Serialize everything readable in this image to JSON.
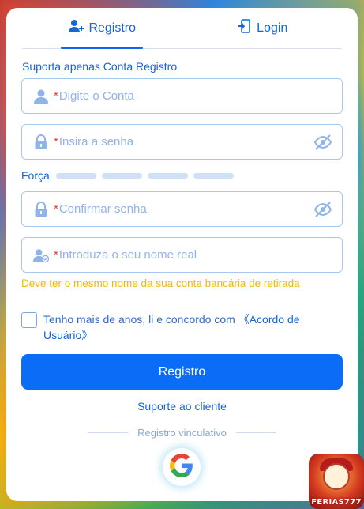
{
  "tabs": {
    "register": "Registro",
    "login": "Login"
  },
  "subtitle": "Suporta apenas Conta Registro",
  "fields": {
    "account": {
      "required_mark": "*",
      "placeholder": "Digite o Conta"
    },
    "password": {
      "required_mark": "*",
      "placeholder": "Insira a senha"
    },
    "confirm_password": {
      "required_mark": "*",
      "placeholder": "Confirmar senha"
    },
    "real_name": {
      "required_mark": "*",
      "placeholder": "Introduza o seu nome real"
    }
  },
  "strength": {
    "label": "Força",
    "level": 0,
    "segments": 4
  },
  "real_name_warning": "Deve ter o mesmo nome da sua conta bancária de retirada",
  "agreement": {
    "text": "Tenho mais de anos, li e concordo com ",
    "link": "《Acordo de Usuário》",
    "checked": false
  },
  "submit_label": "Registro",
  "support_link": "Suporte ao cliente",
  "divider_text": "Registro vinculativo",
  "social": {
    "icon": "google-icon"
  },
  "app_badge": {
    "label": "FERIAS777"
  },
  "colors": {
    "primary": "#0b6cf7",
    "accent_text": "#1565d8",
    "warning": "#f2b705",
    "required": "#e53935"
  }
}
